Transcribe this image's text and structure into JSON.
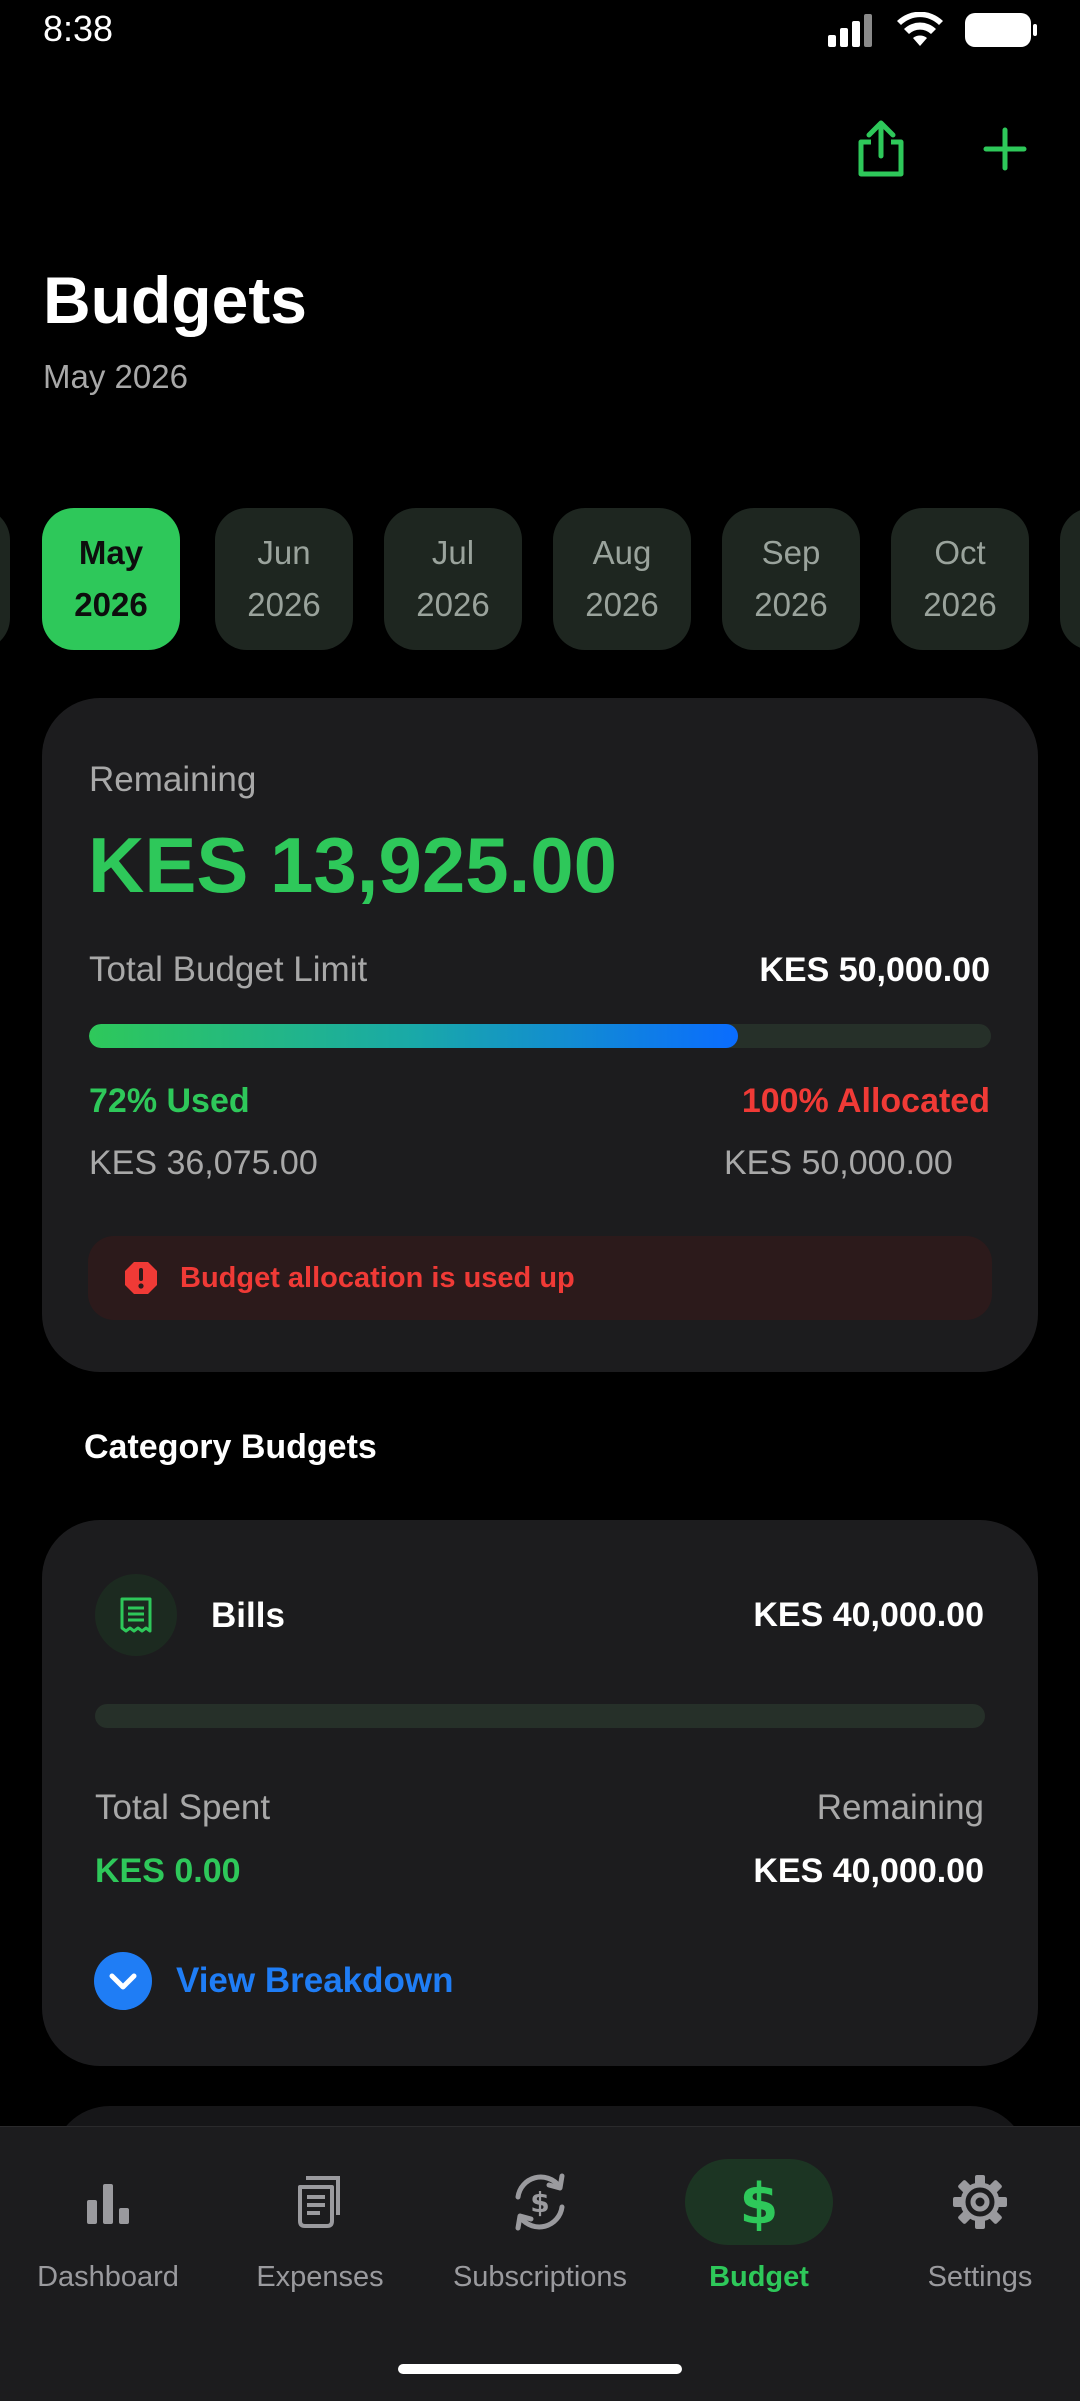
{
  "status": {
    "time": "8:38"
  },
  "header": {
    "title": "Budgets",
    "subtitle": "May 2026"
  },
  "months": [
    {
      "month": "May",
      "year": "2026",
      "active": true
    },
    {
      "month": "Jun",
      "year": "2026",
      "active": false
    },
    {
      "month": "Jul",
      "year": "2026",
      "active": false
    },
    {
      "month": "Aug",
      "year": "2026",
      "active": false
    },
    {
      "month": "Sep",
      "year": "2026",
      "active": false
    },
    {
      "month": "Oct",
      "year": "2026",
      "active": false
    }
  ],
  "summary": {
    "remaining_label": "Remaining",
    "remaining_value": "KES 13,925.00",
    "limit_label": "Total Budget Limit",
    "limit_value": "KES 50,000.00",
    "used_fraction": 0.72,
    "used_label": "72% Used",
    "used_amount": "KES 36,075.00",
    "allocated_label": "100% Allocated",
    "allocated_amount": "KES 50,000.00",
    "alert_text": "Budget allocation is used up"
  },
  "category_section_title": "Category Budgets",
  "category": {
    "name": "Bills",
    "amount": "KES 40,000.00",
    "spent_fraction": 0,
    "spent_label": "Total Spent",
    "spent_value": "KES 0.00",
    "remaining_label": "Remaining",
    "remaining_value": "KES 40,000.00",
    "breakdown_label": "View Breakdown"
  },
  "nav": [
    {
      "label": "Dashboard",
      "icon": "bar-chart-icon",
      "active": false
    },
    {
      "label": "Expenses",
      "icon": "receipt-icon",
      "active": false
    },
    {
      "label": "Subscriptions",
      "icon": "recurring-dollar-icon",
      "active": false
    },
    {
      "label": "Budget",
      "icon": "dollar-icon",
      "active": true
    },
    {
      "label": "Settings",
      "icon": "gear-icon",
      "active": false
    }
  ],
  "colors": {
    "accent": "#2ec85a",
    "danger": "#f03a36",
    "link": "#1f7df5",
    "card": "#1c1c1e"
  }
}
